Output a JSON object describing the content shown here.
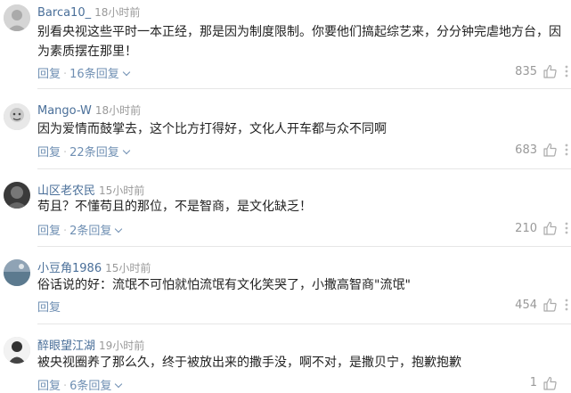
{
  "comments": [
    {
      "username": "Barca10_",
      "time": "18小时前",
      "text": "别看央视这些平时一本正经，那是因为制度限制。你要他们搞起综艺来，分分钟完虐地方台，因为素质摆在那里！",
      "reply_label": "回复",
      "replies_label": "16条回复",
      "likes": "835"
    },
    {
      "username": "Mango-W",
      "time": "18小时前",
      "text": "因为爱情而鼓掌去，这个比方打得好，文化人开车都与众不同啊",
      "reply_label": "回复",
      "replies_label": "22条回复",
      "likes": "683"
    },
    {
      "username": "山区老农民",
      "time": "15小时前",
      "text": "苟且？不懂苟且的那位，不是智商，是文化缺乏！",
      "reply_label": "回复",
      "replies_label": "2条回复",
      "likes": "210"
    },
    {
      "username": "小豆角1986",
      "time": "15小时前",
      "text": "俗话说的好：流氓不可怕就怕流氓有文化笑哭了，小撒高智商\"流氓\"",
      "reply_label": "回复",
      "likes": "454"
    },
    {
      "username": "醉眼望江湖",
      "time": "19小时前",
      "text": "被央视圈养了那么久，终于被放出来的撒手没，啊不对，是撒贝宁，抱歉抱歉",
      "reply_label": "回复",
      "replies_label": "6条回复",
      "likes": "1"
    }
  ],
  "icons": {
    "like": "thumbs-up-icon",
    "more": "more-icon",
    "expand": "chevron-down-icon"
  },
  "colors": {
    "username": "#4a6f99",
    "action": "#6f8fb3",
    "meta": "#999999"
  }
}
